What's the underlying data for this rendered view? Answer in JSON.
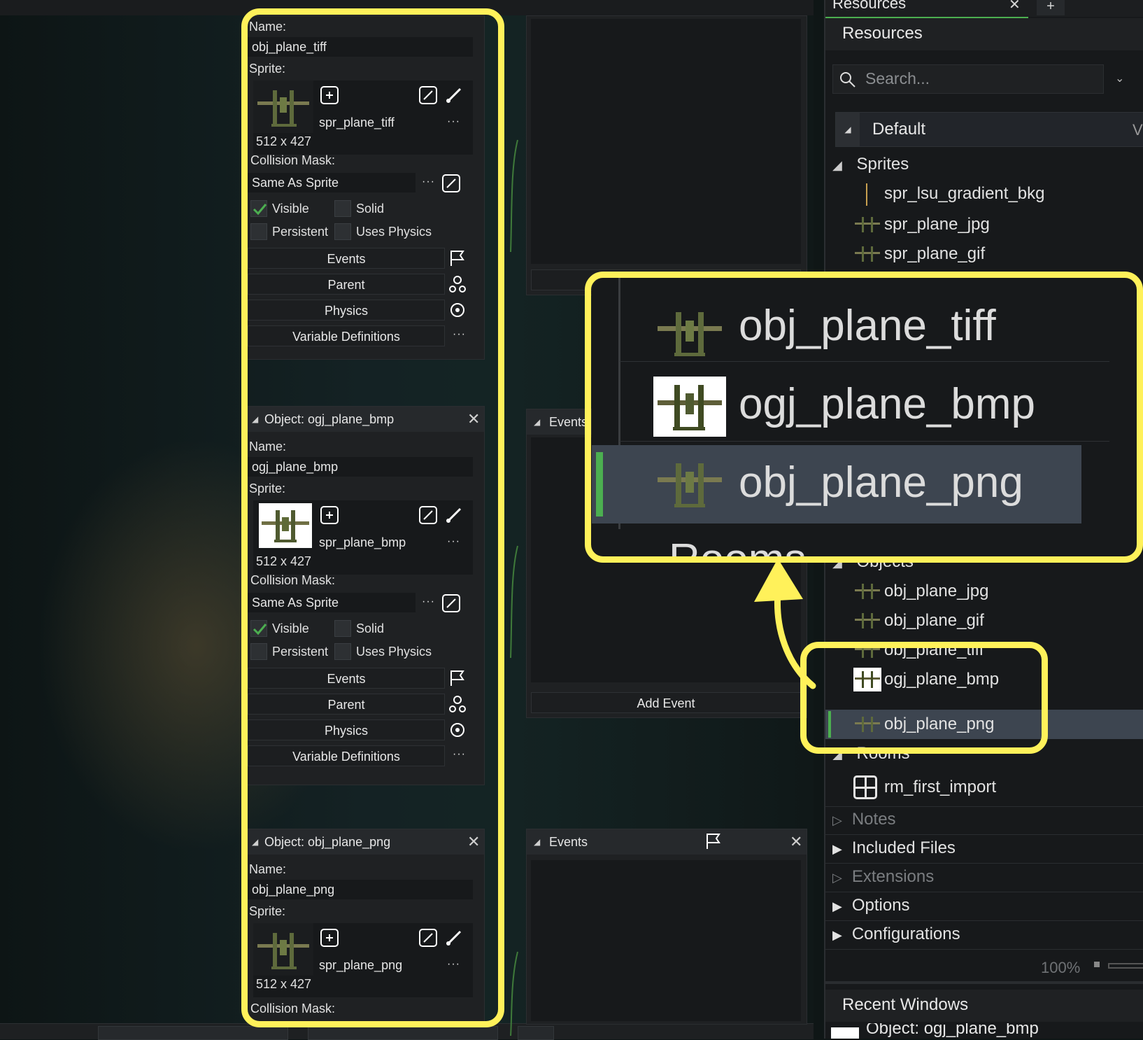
{
  "objects": [
    {
      "title": "",
      "name_label": "Name:",
      "name": "obj_plane_tiff",
      "sprite_label": "Sprite:",
      "sprite": "spr_plane_tiff",
      "size": "512 x 427",
      "collision_label": "Collision Mask:",
      "collision": "Same As Sprite",
      "visible_label": "Visible",
      "solid_label": "Solid",
      "persistent_label": "Persistent",
      "physics_check_label": "Uses Physics",
      "events_btn": "Events",
      "parent_btn": "Parent",
      "physics_btn": "Physics",
      "vars_btn": "Variable Definitions"
    },
    {
      "title": "Object: ogj_plane_bmp",
      "name_label": "Name:",
      "name": "ogj_plane_bmp",
      "sprite_label": "Sprite:",
      "sprite": "spr_plane_bmp",
      "size": "512 x 427",
      "collision_label": "Collision Mask:",
      "collision": "Same As Sprite",
      "visible_label": "Visible",
      "solid_label": "Solid",
      "persistent_label": "Persistent",
      "physics_check_label": "Uses Physics",
      "events_btn": "Events",
      "parent_btn": "Parent",
      "physics_btn": "Physics",
      "vars_btn": "Variable Definitions"
    },
    {
      "title": "Object: obj_plane_png",
      "name_label": "Name:",
      "name": "obj_plane_png",
      "sprite_label": "Sprite:",
      "sprite": "spr_plane_png",
      "size": "512 x 427",
      "collision_label": "Collision Mask:"
    }
  ],
  "events_panels": {
    "title": "Events",
    "add_event": "Add Event"
  },
  "resources": {
    "tab_label": "Resources",
    "tab_add": "+",
    "header": "Resources",
    "search_placeholder": "Search...",
    "group": "Default",
    "group_suffix": "V",
    "sprites_label": "Sprites",
    "sprites": [
      "spr_lsu_gradient_bkg",
      "spr_plane_jpg",
      "spr_plane_gif"
    ],
    "objects_label": "Objects",
    "objects": [
      "obj_plane_jpg",
      "obj_plane_gif",
      "obj_plane_tiff",
      "ogj_plane_bmp",
      "obj_plane_png"
    ],
    "rooms_label": "Rooms",
    "rooms": [
      "rm_first_import"
    ],
    "notes": "Notes",
    "included_files": "Included Files",
    "extensions": "Extensions",
    "options": "Options",
    "configurations": "Configurations",
    "zoom": "100%",
    "recent_windows": "Recent Windows",
    "recent_item": "Object: ogj_plane_bmp"
  },
  "zoom_callout": {
    "items": [
      "obj_plane_tiff",
      "ogj_plane_bmp",
      "obj_plane_png"
    ],
    "partial": "Rooms"
  },
  "colors": {
    "highlight": "#fff15a",
    "accent_green": "#4caf50",
    "selected_row": "#3d4550"
  }
}
